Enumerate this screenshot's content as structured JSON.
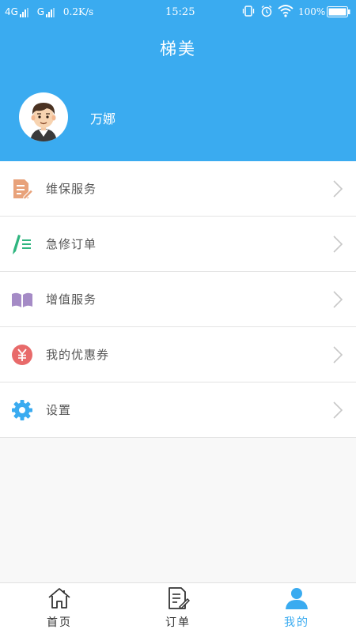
{
  "status_bar": {
    "network1": "4G",
    "network2": "G",
    "speed": "0.2K/s",
    "time": "15:25",
    "battery": "100%"
  },
  "header": {
    "title": "梯美",
    "username": "万娜"
  },
  "menu": {
    "items": [
      {
        "label": "维保服务",
        "icon": "document-edit-icon"
      },
      {
        "label": "急修订单",
        "icon": "pen-list-icon"
      },
      {
        "label": "增值服务",
        "icon": "open-book-icon"
      },
      {
        "label": "我的优惠券",
        "icon": "yuan-coupon-icon"
      },
      {
        "label": "设置",
        "icon": "gear-icon"
      }
    ]
  },
  "tabbar": {
    "tabs": [
      {
        "label": "首页",
        "icon": "home-icon"
      },
      {
        "label": "订单",
        "icon": "order-icon"
      },
      {
        "label": "我的",
        "icon": "user-icon"
      }
    ],
    "active_index": 2
  },
  "colors": {
    "primary": "#3aabf0",
    "active_tab": "#3aabf0",
    "icon_orange": "#e8a27a",
    "icon_green": "#2fb57f",
    "icon_purple": "#a58bc6",
    "icon_red": "#e86a6a",
    "icon_blue": "#3aabf0"
  }
}
